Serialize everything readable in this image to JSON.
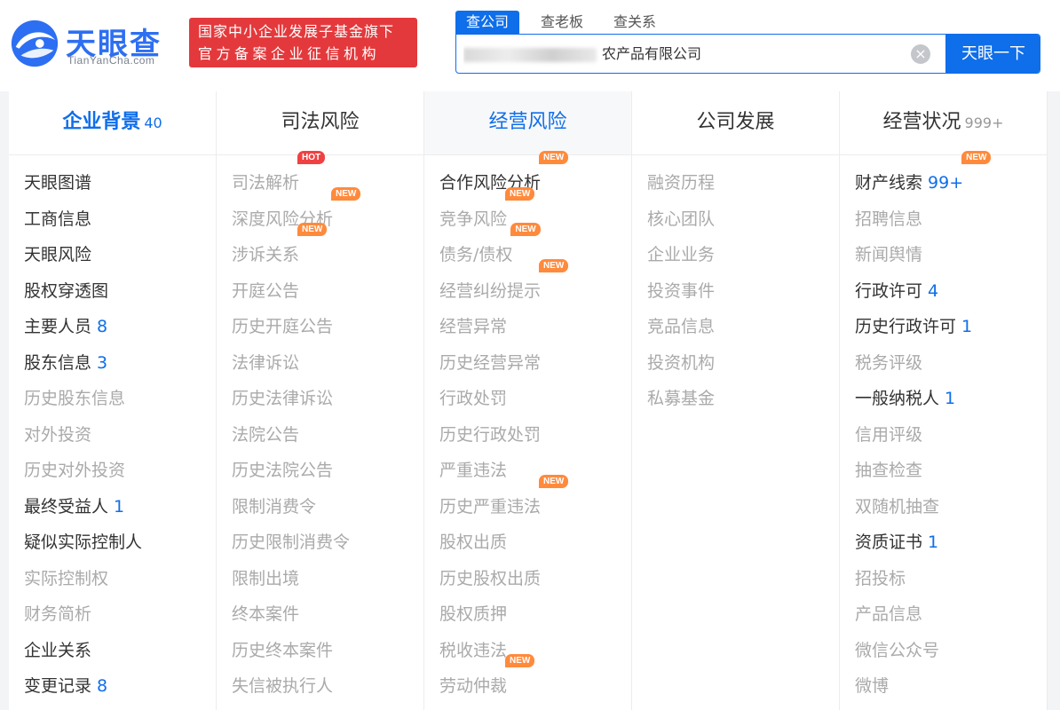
{
  "header": {
    "logo_text": "天眼查",
    "logo_sub": "TianYanCha.com",
    "badge_line1": "国家中小企业发展子基金旗下",
    "badge_line2": "官方备案企业征信机构"
  },
  "search": {
    "tabs": [
      "查公司",
      "查老板",
      "查关系"
    ],
    "active_tab": "查公司",
    "query_visible": "农产品有限公司",
    "button": "天眼一下",
    "clear_icon": "×"
  },
  "columns": [
    {
      "title": "企业背景",
      "count": "40",
      "style": "blue",
      "items": [
        {
          "label": "天眼图谱",
          "dark": true
        },
        {
          "label": "工商信息",
          "dark": true
        },
        {
          "label": "天眼风险",
          "dark": true
        },
        {
          "label": "股权穿透图",
          "dark": true
        },
        {
          "label": "主要人员",
          "num": "8",
          "dark": true
        },
        {
          "label": "股东信息",
          "num": "3",
          "dark": true
        },
        {
          "label": "历史股东信息"
        },
        {
          "label": "对外投资"
        },
        {
          "label": "历史对外投资"
        },
        {
          "label": "最终受益人",
          "num": "1",
          "dark": true
        },
        {
          "label": "疑似实际控制人",
          "dark": true
        },
        {
          "label": "实际控制权"
        },
        {
          "label": "财务简析"
        },
        {
          "label": "企业关系",
          "dark": true
        },
        {
          "label": "变更记录",
          "num": "8",
          "dark": true
        }
      ]
    },
    {
      "title": "司法风险",
      "count": "",
      "items": [
        {
          "label": "司法解析",
          "tag": "HOT"
        },
        {
          "label": "深度风险分析",
          "tag": "NEW"
        },
        {
          "label": "涉诉关系",
          "tag": "NEW"
        },
        {
          "label": "开庭公告"
        },
        {
          "label": "历史开庭公告"
        },
        {
          "label": "法律诉讼"
        },
        {
          "label": "历史法律诉讼"
        },
        {
          "label": "法院公告"
        },
        {
          "label": "历史法院公告"
        },
        {
          "label": "限制消费令"
        },
        {
          "label": "历史限制消费令"
        },
        {
          "label": "限制出境"
        },
        {
          "label": "终本案件"
        },
        {
          "label": "历史终本案件"
        },
        {
          "label": "失信被执行人"
        }
      ]
    },
    {
      "title": "经营风险",
      "count": "",
      "style": "blue-shade",
      "items": [
        {
          "label": "合作风险分析",
          "tag": "NEW",
          "dark": true
        },
        {
          "label": "竞争风险",
          "tag": "NEW"
        },
        {
          "label": "债务/债权",
          "tag": "NEW"
        },
        {
          "label": "经营纠纷提示",
          "tag": "NEW"
        },
        {
          "label": "经营异常"
        },
        {
          "label": "历史经营异常"
        },
        {
          "label": "行政处罚"
        },
        {
          "label": "历史行政处罚"
        },
        {
          "label": "严重违法"
        },
        {
          "label": "历史严重违法",
          "tag": "NEW"
        },
        {
          "label": "股权出质"
        },
        {
          "label": "历史股权出质"
        },
        {
          "label": "股权质押"
        },
        {
          "label": "税收违法"
        },
        {
          "label": "劳动仲裁",
          "tag": "NEW"
        }
      ]
    },
    {
      "title": "公司发展",
      "count": "",
      "items": [
        {
          "label": "融资历程"
        },
        {
          "label": "核心团队"
        },
        {
          "label": "企业业务"
        },
        {
          "label": "投资事件"
        },
        {
          "label": "竞品信息"
        },
        {
          "label": "投资机构"
        },
        {
          "label": "私募基金"
        }
      ]
    },
    {
      "title": "经营状况",
      "count": "999+",
      "items": [
        {
          "label": "财产线索",
          "num": "99+",
          "tag": "NEW",
          "dark": true
        },
        {
          "label": "招聘信息"
        },
        {
          "label": "新闻舆情"
        },
        {
          "label": "行政许可",
          "num": "4",
          "dark": true
        },
        {
          "label": "历史行政许可",
          "num": "1",
          "dark": true
        },
        {
          "label": "税务评级"
        },
        {
          "label": "一般纳税人",
          "num": "1",
          "dark": true
        },
        {
          "label": "信用评级"
        },
        {
          "label": "抽查检查"
        },
        {
          "label": "双随机抽查"
        },
        {
          "label": "资质证书",
          "num": "1",
          "dark": true
        },
        {
          "label": "招投标"
        },
        {
          "label": "产品信息"
        },
        {
          "label": "微信公众号"
        },
        {
          "label": "微博"
        }
      ]
    }
  ],
  "colors": {
    "brand_blue": "#0f6eea",
    "badge_red": "#e4393c",
    "tag_new": "#ff8a3c",
    "tag_hot": "#f04142"
  }
}
